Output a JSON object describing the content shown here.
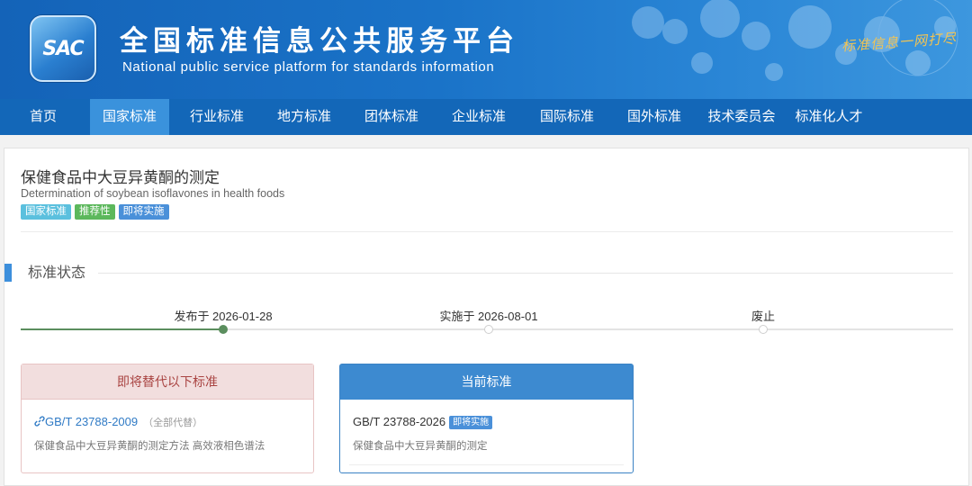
{
  "header": {
    "logo_text": "SAC",
    "title": "全国标准信息公共服务平台",
    "subtitle": "National public service platform  for standards information",
    "slogan": "标准信息一网打尽"
  },
  "nav": {
    "items": [
      {
        "label": "首页",
        "active": false
      },
      {
        "label": "国家标准",
        "active": true
      },
      {
        "label": "行业标准",
        "active": false
      },
      {
        "label": "地方标准",
        "active": false
      },
      {
        "label": "团体标准",
        "active": false
      },
      {
        "label": "企业标准",
        "active": false
      },
      {
        "label": "国际标准",
        "active": false
      },
      {
        "label": "国外标准",
        "active": false
      },
      {
        "label": "技术委员会",
        "active": false
      },
      {
        "label": "标准化人才",
        "active": false
      }
    ]
  },
  "standard": {
    "title_cn": "保健食品中大豆异黄酮的测定",
    "title_en": "Determination of soybean isoflavones in health foods",
    "tags": [
      {
        "label": "国家标准",
        "color": "#5bc0de"
      },
      {
        "label": "推荐性",
        "color": "#5cb85c"
      },
      {
        "label": "即将实施",
        "color": "#4a90d9"
      }
    ]
  },
  "status": {
    "section_title": "标准状态",
    "timeline": [
      {
        "label": "发布于 2026-01-28",
        "done": true
      },
      {
        "label": "实施于 2026-08-01",
        "done": false
      },
      {
        "label": "废止",
        "done": false
      }
    ]
  },
  "replace_box": {
    "header": "即将替代以下标准",
    "code": "GB/T 23788-2009",
    "note": "（全部代替）",
    "desc": "保健食品中大豆异黄酮的测定方法 高效液相色谱法"
  },
  "current_box": {
    "header": "当前标准",
    "code": "GB/T 23788-2026",
    "badge": "即将实施",
    "desc": "保健食品中大豆异黄酮的测定"
  },
  "icons": {
    "link": "link-icon"
  },
  "colors": {
    "header_blue": "#1a73c8",
    "nav_blue": "#1367b8",
    "nav_active": "#3a92dc",
    "progress_green": "#5b8e5e",
    "danger_text": "#a94442"
  }
}
